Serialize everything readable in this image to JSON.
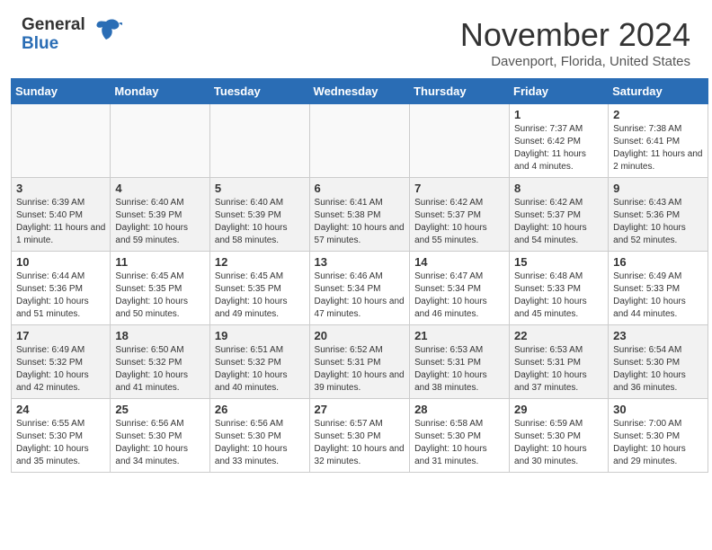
{
  "header": {
    "logo_text1": "General",
    "logo_text2": "Blue",
    "month": "November 2024",
    "location": "Davenport, Florida, United States"
  },
  "weekdays": [
    "Sunday",
    "Monday",
    "Tuesday",
    "Wednesday",
    "Thursday",
    "Friday",
    "Saturday"
  ],
  "weeks": [
    [
      {
        "day": "",
        "info": ""
      },
      {
        "day": "",
        "info": ""
      },
      {
        "day": "",
        "info": ""
      },
      {
        "day": "",
        "info": ""
      },
      {
        "day": "",
        "info": ""
      },
      {
        "day": "1",
        "info": "Sunrise: 7:37 AM\nSunset: 6:42 PM\nDaylight: 11 hours and 4 minutes."
      },
      {
        "day": "2",
        "info": "Sunrise: 7:38 AM\nSunset: 6:41 PM\nDaylight: 11 hours and 2 minutes."
      }
    ],
    [
      {
        "day": "3",
        "info": "Sunrise: 6:39 AM\nSunset: 5:40 PM\nDaylight: 11 hours and 1 minute."
      },
      {
        "day": "4",
        "info": "Sunrise: 6:40 AM\nSunset: 5:39 PM\nDaylight: 10 hours and 59 minutes."
      },
      {
        "day": "5",
        "info": "Sunrise: 6:40 AM\nSunset: 5:39 PM\nDaylight: 10 hours and 58 minutes."
      },
      {
        "day": "6",
        "info": "Sunrise: 6:41 AM\nSunset: 5:38 PM\nDaylight: 10 hours and 57 minutes."
      },
      {
        "day": "7",
        "info": "Sunrise: 6:42 AM\nSunset: 5:37 PM\nDaylight: 10 hours and 55 minutes."
      },
      {
        "day": "8",
        "info": "Sunrise: 6:42 AM\nSunset: 5:37 PM\nDaylight: 10 hours and 54 minutes."
      },
      {
        "day": "9",
        "info": "Sunrise: 6:43 AM\nSunset: 5:36 PM\nDaylight: 10 hours and 52 minutes."
      }
    ],
    [
      {
        "day": "10",
        "info": "Sunrise: 6:44 AM\nSunset: 5:36 PM\nDaylight: 10 hours and 51 minutes."
      },
      {
        "day": "11",
        "info": "Sunrise: 6:45 AM\nSunset: 5:35 PM\nDaylight: 10 hours and 50 minutes."
      },
      {
        "day": "12",
        "info": "Sunrise: 6:45 AM\nSunset: 5:35 PM\nDaylight: 10 hours and 49 minutes."
      },
      {
        "day": "13",
        "info": "Sunrise: 6:46 AM\nSunset: 5:34 PM\nDaylight: 10 hours and 47 minutes."
      },
      {
        "day": "14",
        "info": "Sunrise: 6:47 AM\nSunset: 5:34 PM\nDaylight: 10 hours and 46 minutes."
      },
      {
        "day": "15",
        "info": "Sunrise: 6:48 AM\nSunset: 5:33 PM\nDaylight: 10 hours and 45 minutes."
      },
      {
        "day": "16",
        "info": "Sunrise: 6:49 AM\nSunset: 5:33 PM\nDaylight: 10 hours and 44 minutes."
      }
    ],
    [
      {
        "day": "17",
        "info": "Sunrise: 6:49 AM\nSunset: 5:32 PM\nDaylight: 10 hours and 42 minutes."
      },
      {
        "day": "18",
        "info": "Sunrise: 6:50 AM\nSunset: 5:32 PM\nDaylight: 10 hours and 41 minutes."
      },
      {
        "day": "19",
        "info": "Sunrise: 6:51 AM\nSunset: 5:32 PM\nDaylight: 10 hours and 40 minutes."
      },
      {
        "day": "20",
        "info": "Sunrise: 6:52 AM\nSunset: 5:31 PM\nDaylight: 10 hours and 39 minutes."
      },
      {
        "day": "21",
        "info": "Sunrise: 6:53 AM\nSunset: 5:31 PM\nDaylight: 10 hours and 38 minutes."
      },
      {
        "day": "22",
        "info": "Sunrise: 6:53 AM\nSunset: 5:31 PM\nDaylight: 10 hours and 37 minutes."
      },
      {
        "day": "23",
        "info": "Sunrise: 6:54 AM\nSunset: 5:30 PM\nDaylight: 10 hours and 36 minutes."
      }
    ],
    [
      {
        "day": "24",
        "info": "Sunrise: 6:55 AM\nSunset: 5:30 PM\nDaylight: 10 hours and 35 minutes."
      },
      {
        "day": "25",
        "info": "Sunrise: 6:56 AM\nSunset: 5:30 PM\nDaylight: 10 hours and 34 minutes."
      },
      {
        "day": "26",
        "info": "Sunrise: 6:56 AM\nSunset: 5:30 PM\nDaylight: 10 hours and 33 minutes."
      },
      {
        "day": "27",
        "info": "Sunrise: 6:57 AM\nSunset: 5:30 PM\nDaylight: 10 hours and 32 minutes."
      },
      {
        "day": "28",
        "info": "Sunrise: 6:58 AM\nSunset: 5:30 PM\nDaylight: 10 hours and 31 minutes."
      },
      {
        "day": "29",
        "info": "Sunrise: 6:59 AM\nSunset: 5:30 PM\nDaylight: 10 hours and 30 minutes."
      },
      {
        "day": "30",
        "info": "Sunrise: 7:00 AM\nSunset: 5:30 PM\nDaylight: 10 hours and 29 minutes."
      }
    ]
  ]
}
